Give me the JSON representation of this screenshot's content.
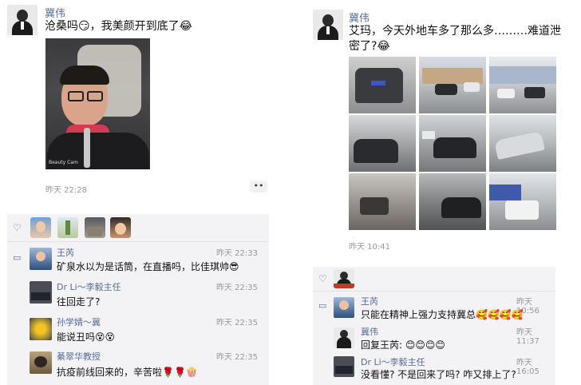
{
  "left_post": {
    "author": "冀伟",
    "text": "沧桑吗😏，我美颜开到底了😂",
    "watermark": "Beauty Cam",
    "time": "昨天 22:28",
    "more": "••",
    "likes_icon": "heart-outline-icon",
    "comments": [
      {
        "name": "王芮",
        "time": "昨天 22:33",
        "text": "矿泉水以为是话筒，在直播吗，比佳琪帅😎"
      },
      {
        "name": "Dr Li～李毅主任",
        "time": "昨天 22:35",
        "text": "往回走了?"
      },
      {
        "name": "孙学婧～冀",
        "time": "昨天 22:35",
        "text": "能说丑吗😵😵"
      },
      {
        "name": "綦翠华教授",
        "time": "昨天 22:35",
        "text": "抗疫前线回来的，辛苦啦🌹🌹🍿"
      }
    ]
  },
  "right_post": {
    "author": "冀伟",
    "text_line1": "艾玛，今天外地车多了那么多………难道泄",
    "text_line2": "密了?😂",
    "time": "昨天 10:41",
    "comments": [
      {
        "name": "王芮",
        "time": "昨天 10:56",
        "text": "只能在精神上强力支持冀总🥰🥰🥰🥰"
      },
      {
        "name": "冀伟",
        "time": "昨天 11:37",
        "text": "回复王芮: 😊😊😊😊"
      },
      {
        "name": "Dr Li～李毅主任",
        "time": "昨天 16:05",
        "text": "没看懂? 不是回来了吗? 咋又排上了?"
      }
    ]
  },
  "colors": {
    "link": "#576b95",
    "muted": "#999999",
    "panel_bg": "#f3f3f5"
  }
}
